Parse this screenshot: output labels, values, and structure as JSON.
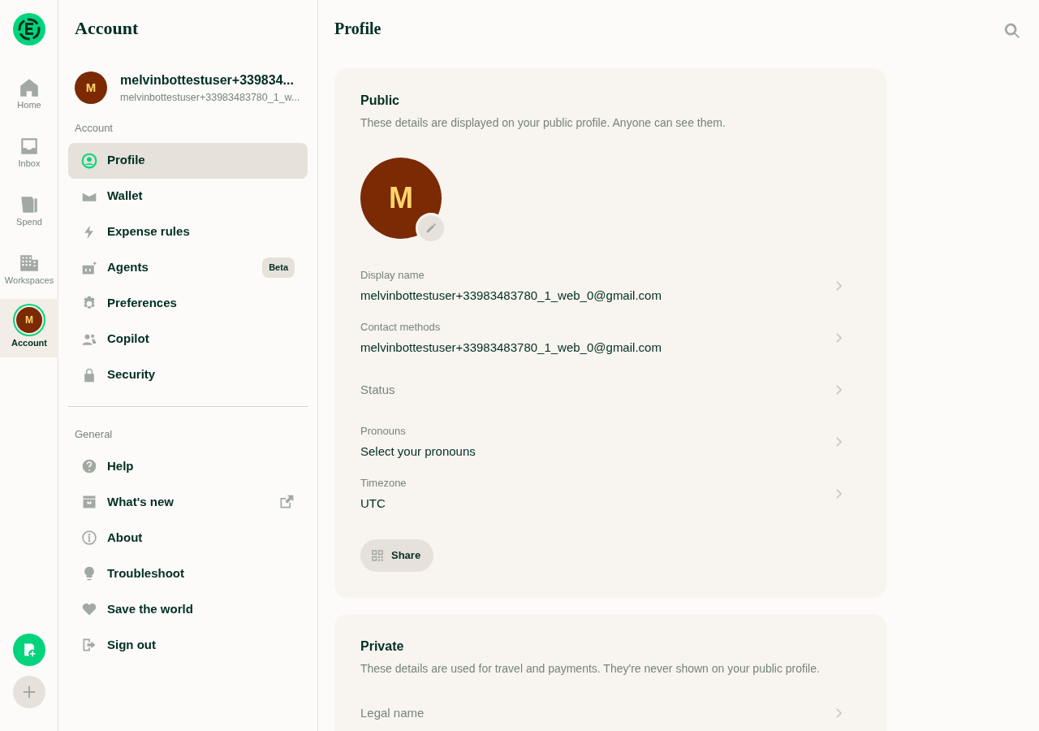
{
  "rail": {
    "items": [
      {
        "kind": "icon",
        "label": "Home",
        "selected": false
      },
      {
        "kind": "icon",
        "label": "Inbox",
        "selected": false
      },
      {
        "kind": "icon",
        "label": "Spend",
        "selected": false
      },
      {
        "kind": "icon",
        "label": "Workspaces",
        "selected": false
      },
      {
        "kind": "avatar",
        "label": "Account",
        "initial": "M",
        "selected": true
      }
    ]
  },
  "sidebar": {
    "title": "Account",
    "user": {
      "initial": "M",
      "name": "melvinbottestuser+339834...",
      "email": "melvinbottestuser+33983483780_1_w..."
    },
    "sections": [
      {
        "label": "Account",
        "items": [
          {
            "label": "Profile",
            "selected": true,
            "external": false
          },
          {
            "label": "Wallet",
            "selected": false,
            "external": false
          },
          {
            "label": "Expense rules",
            "selected": false,
            "external": false
          },
          {
            "label": "Agents",
            "selected": false,
            "external": false,
            "badge": "Beta"
          },
          {
            "label": "Preferences",
            "selected": false,
            "external": false
          },
          {
            "label": "Copilot",
            "selected": false,
            "external": false
          },
          {
            "label": "Security",
            "selected": false,
            "external": false
          }
        ]
      },
      {
        "label": "General",
        "items": [
          {
            "label": "Help",
            "selected": false,
            "external": false
          },
          {
            "label": "What's new",
            "selected": false,
            "external": true
          },
          {
            "label": "About",
            "selected": false,
            "external": false
          },
          {
            "label": "Troubleshoot",
            "selected": false,
            "external": false
          },
          {
            "label": "Save the world",
            "selected": false,
            "external": false
          },
          {
            "label": "Sign out",
            "selected": false,
            "external": false
          }
        ]
      }
    ]
  },
  "main": {
    "title": "Profile",
    "cards": [
      {
        "title": "Public",
        "description": "These details are displayed on your public profile. Anyone can see them.",
        "avatar": "M",
        "rows": [
          {
            "label": "Display name",
            "value": "melvinbottestuser+33983483780_1_web_0@gmail.com"
          },
          {
            "label": "Contact methods",
            "value": "melvinbottestuser+33983483780_1_web_0@gmail.com"
          },
          {
            "label": "Status"
          },
          {
            "label": "Pronouns",
            "value": "Select your pronouns"
          },
          {
            "label": "Timezone",
            "value": "UTC"
          }
        ],
        "button": "Share"
      },
      {
        "title": "Private",
        "description": "These details are used for travel and payments. They're never shown on your public profile.",
        "rows": [
          {
            "label": "Legal name"
          }
        ]
      }
    ]
  }
}
